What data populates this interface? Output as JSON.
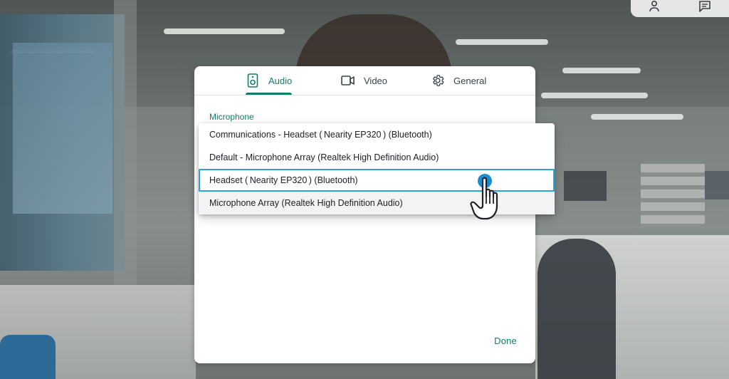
{
  "tabs": [
    {
      "label": "Audio",
      "icon": "speaker-icon",
      "active": true
    },
    {
      "label": "Video",
      "icon": "video-camera-icon",
      "active": false
    },
    {
      "label": "General",
      "icon": "gear-icon",
      "active": false
    }
  ],
  "microphone": {
    "section_label": "Microphone",
    "options": [
      "Communications - Headset ( Nearity EP320 ) (Bluetooth)",
      "Default - Microphone Array (Realtek High Definition Audio)",
      "Headset ( Nearity EP320 ) (Bluetooth)",
      "Microphone Array (Realtek High Definition Audio)"
    ],
    "highlighted_index": 2
  },
  "footer": {
    "done_label": "Done"
  },
  "colors": {
    "accent": "#137b6b",
    "selection_border": "#2aa5d6",
    "click_dot": "#1e8ccf"
  },
  "overlay_icons": [
    "people-icon",
    "chat-icon"
  ]
}
